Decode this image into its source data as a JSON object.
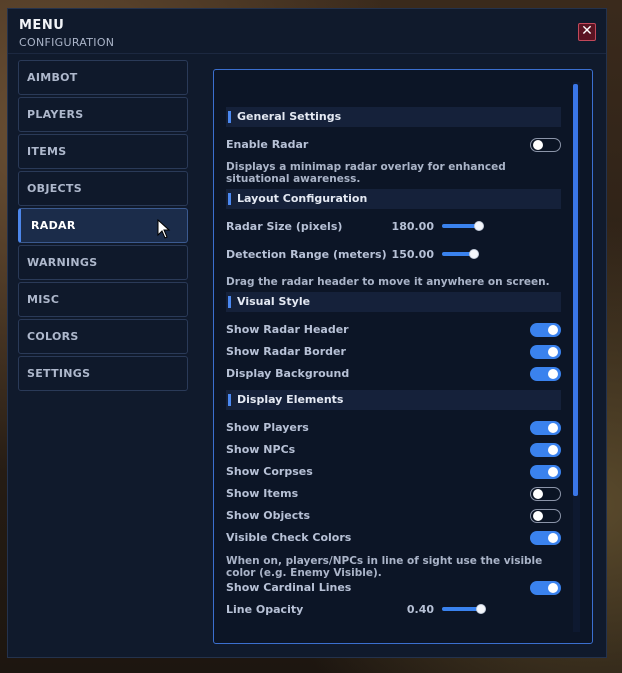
{
  "header": {
    "title": "MENU",
    "subtitle": "CONFIGURATION",
    "close_glyph": "✕"
  },
  "sidebar": {
    "items": [
      {
        "label": "AIMBOT"
      },
      {
        "label": "PLAYERS"
      },
      {
        "label": "ITEMS"
      },
      {
        "label": "OBJECTS"
      },
      {
        "label": "RADAR",
        "active": true
      },
      {
        "label": "WARNINGS"
      },
      {
        "label": "MISC"
      },
      {
        "label": "COLORS"
      },
      {
        "label": "SETTINGS"
      }
    ]
  },
  "panel": {
    "general": {
      "title": "General Settings",
      "enable_radar": {
        "label": "Enable Radar",
        "on": false
      },
      "description": "Displays a minimap radar overlay for enhanced situational awareness."
    },
    "layout": {
      "title": "Layout Configuration",
      "radar_size": {
        "label": "Radar Size (pixels)",
        "value": "180.00",
        "fraction": 0.85
      },
      "detection_range": {
        "label": "Detection Range (meters)",
        "value": "150.00",
        "fraction": 0.72
      },
      "hint": "Drag the radar header to move it anywhere on screen."
    },
    "visual": {
      "title": "Visual Style",
      "show_radar_header": {
        "label": "Show Radar Header",
        "on": true
      },
      "show_radar_border": {
        "label": "Show Radar Border",
        "on": true
      },
      "display_background": {
        "label": "Display Background",
        "on": true
      }
    },
    "elements": {
      "title": "Display Elements",
      "show_players": {
        "label": "Show Players",
        "on": true
      },
      "show_npcs": {
        "label": "Show NPCs",
        "on": true
      },
      "show_corpses": {
        "label": "Show Corpses",
        "on": true
      },
      "show_items": {
        "label": "Show Items",
        "on": false
      },
      "show_objects": {
        "label": "Show Objects",
        "on": false
      },
      "visible_check_colors": {
        "label": "Visible Check Colors",
        "on": true
      },
      "visible_check_desc": "When on, players/NPCs in line of sight use the visible color (e.g. Enemy Visible).",
      "show_cardinal_lines": {
        "label": "Show Cardinal Lines",
        "on": true
      },
      "line_opacity": {
        "label": "Line Opacity",
        "value": "0.40",
        "fraction": 0.88
      }
    }
  },
  "colors": {
    "accent": "#3a82ee",
    "panel_border": "#3b6fcf",
    "close_border": "#c2485a"
  }
}
